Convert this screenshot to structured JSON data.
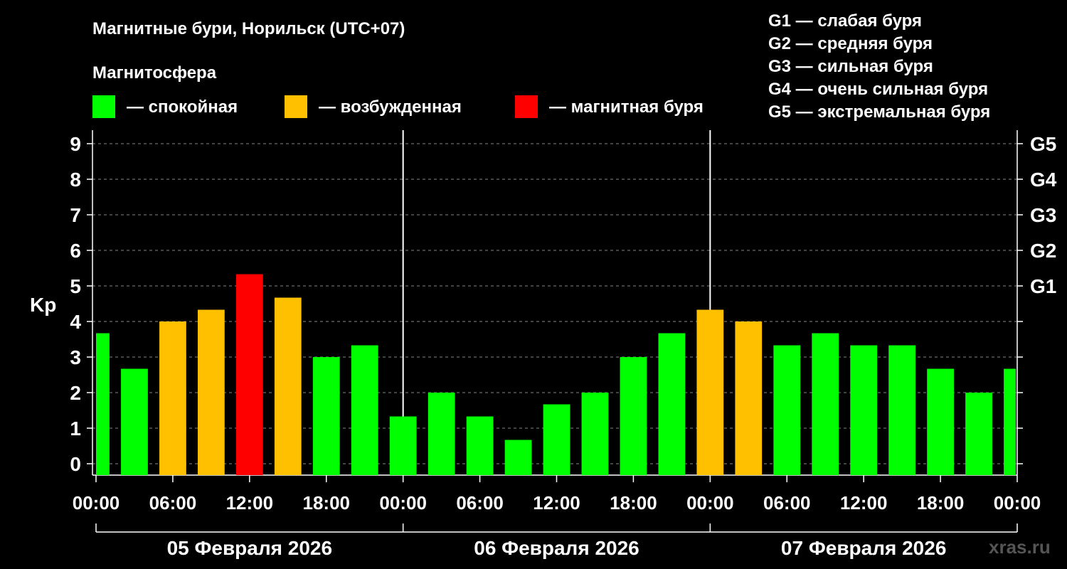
{
  "title": "Магнитные бури, Норильск (UTC+07)",
  "legend": {
    "heading": "Магнитосфера",
    "items": [
      {
        "label": "— спокойная",
        "color": "#00ff00"
      },
      {
        "label": "— возбужденная",
        "color": "#ffc000"
      },
      {
        "label": "— магнитная буря",
        "color": "#ff0000"
      }
    ]
  },
  "storm_scale": [
    "G1 — слабая буря",
    "G2 — средняя буря",
    "G3 — сильная буря",
    "G4 — очень сильная буря",
    "G5 — экстремальная буря"
  ],
  "watermark": "xras.ru",
  "chart_data": {
    "type": "bar",
    "ylabel": "Kp",
    "ylim": [
      0,
      9
    ],
    "yticks": [
      0,
      1,
      2,
      3,
      4,
      5,
      6,
      7,
      8,
      9
    ],
    "right_ticks": [
      {
        "value": 5,
        "label": "G1"
      },
      {
        "value": 6,
        "label": "G2"
      },
      {
        "value": 7,
        "label": "G3"
      },
      {
        "value": 8,
        "label": "G4"
      },
      {
        "value": 9,
        "label": "G5"
      }
    ],
    "xtick_labels": [
      "00:00",
      "06:00",
      "12:00",
      "18:00",
      "00:00",
      "06:00",
      "12:00",
      "18:00",
      "00:00",
      "06:00",
      "12:00",
      "18:00",
      "00:00"
    ],
    "dates": [
      "05 Февраля 2026",
      "06 Февраля 2026",
      "07 Февраля 2026"
    ],
    "bar_interval_hours": 3,
    "values": [
      3.67,
      2.67,
      4.0,
      4.33,
      5.33,
      4.67,
      3.0,
      3.33,
      1.33,
      2.0,
      1.33,
      0.67,
      1.67,
      2.0,
      3.0,
      3.67,
      4.33,
      4.0,
      3.33,
      3.67,
      3.33,
      3.33,
      2.67,
      2.0,
      2.67
    ],
    "colors": {
      "quiet": "#00ff00",
      "unsettled": "#ffc000",
      "storm": "#ff0000"
    },
    "grid": true
  }
}
